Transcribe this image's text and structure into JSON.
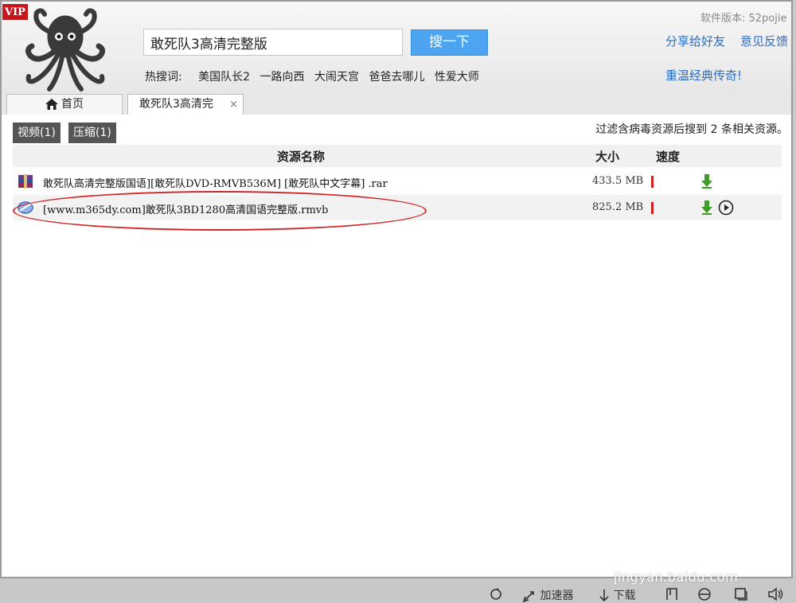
{
  "header": {
    "vip_label": "VIP",
    "search_value": "敢死队3高清完整版",
    "search_button": "搜一下",
    "hot_label": "热搜词:",
    "hot_words": [
      "美国队长2",
      "一路向西",
      "大闹天宫",
      "爸爸去哪儿",
      "性爱大师"
    ],
    "version": "软件版本: 52pojie",
    "share_link": "分享给好友",
    "feedback_link": "意见反馈",
    "classic_link": "重温经典传奇!"
  },
  "tabs": {
    "home": "首页",
    "search": "敢死队3高清完",
    "close": "×"
  },
  "filters": [
    {
      "label": "视频(1)"
    },
    {
      "label": "压缩(1)"
    }
  ],
  "summary": "过滤含病毒资源后搜到 2 条相关资源。",
  "table": {
    "headers": {
      "name": "资源名称",
      "size": "大小",
      "speed": "速度"
    },
    "rows": [
      {
        "name": "敢死队高清完整版国语][敢死队DVD-RMVB536M] [敢死队中文字幕] .rar",
        "size": "433.5 MB",
        "icon": "rar-archive-icon"
      },
      {
        "name": "[www.m365dy.com]敢死队3BD1280高清国语完整版.rmvb",
        "size": "825.2 MB",
        "icon": "video-file-icon"
      }
    ]
  },
  "watermark": {
    "url": "jingyan.baidu.com"
  },
  "statusbar": {
    "accelerator": "加速器",
    "download": "下载"
  }
}
